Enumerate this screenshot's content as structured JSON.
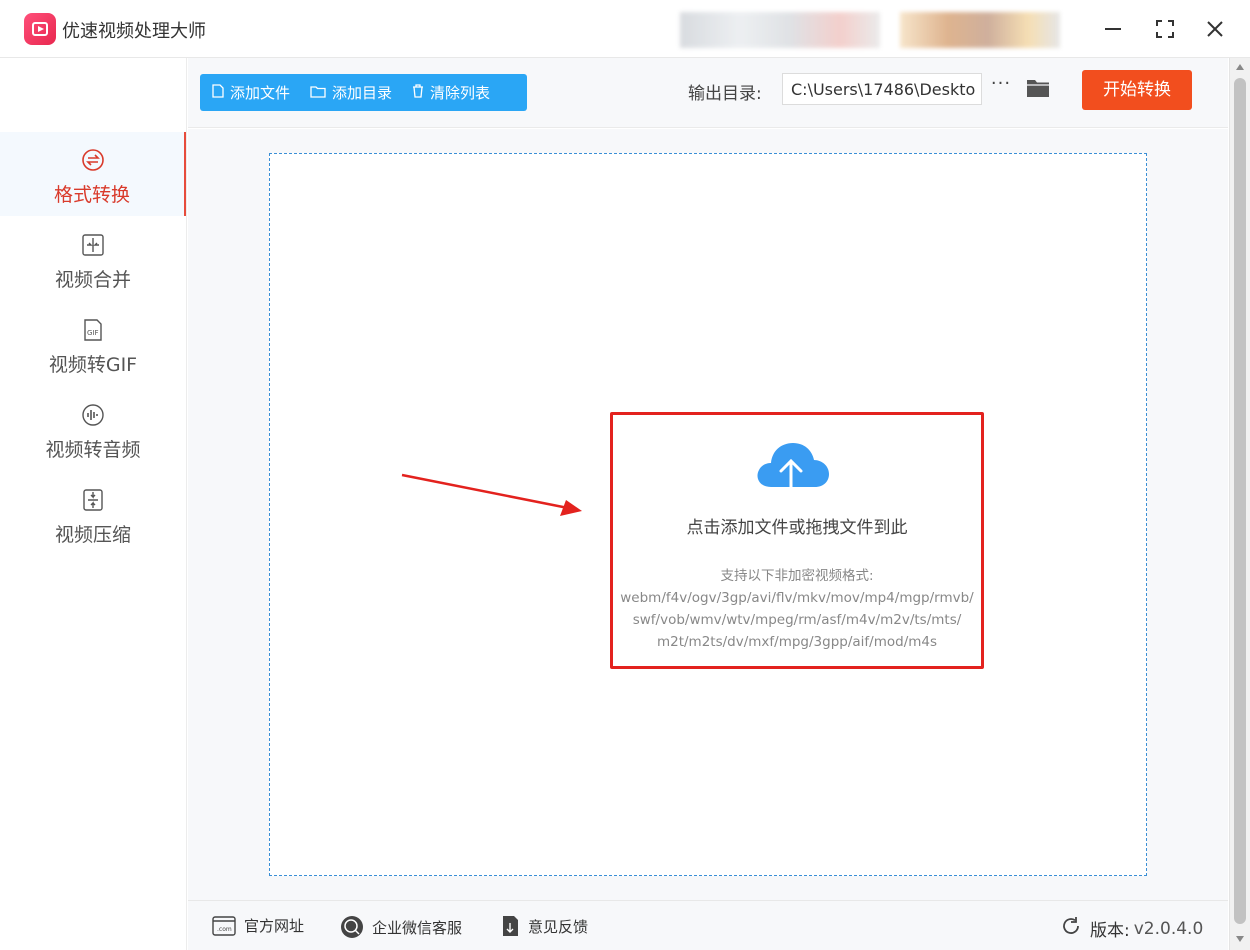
{
  "app": {
    "title": "优速视频处理大师"
  },
  "sidebar": {
    "items": [
      {
        "label": "格式转换",
        "icon": "format-convert-icon",
        "active": true
      },
      {
        "label": "视频合并",
        "icon": "merge-icon",
        "active": false
      },
      {
        "label": "视频转GIF",
        "icon": "gif-icon",
        "active": false
      },
      {
        "label": "视频转音频",
        "icon": "audio-icon",
        "active": false
      },
      {
        "label": "视频压缩",
        "icon": "compress-icon",
        "active": false
      }
    ]
  },
  "toolbar": {
    "add_file": "添加文件",
    "add_dir": "添加目录",
    "clear_list": "清除列表",
    "output_label": "输出目录:",
    "output_path": "C:\\Users\\17486\\Deskto",
    "more": "···",
    "start": "开始转换"
  },
  "dropzone": {
    "title": "点击添加文件或拖拽文件到此",
    "formats_heading": "支持以下非加密视频格式:",
    "formats_lines": [
      "webm/f4v/ogv/3gp/avi/flv/mkv/mov/mp4/mgp/rmvb/",
      "swf/vob/wmv/wtv/mpeg/rm/asf/m4v/m2v/ts/mts/",
      "m2t/m2ts/dv/mxf/mpg/3gpp/aif/mod/m4s"
    ]
  },
  "footer": {
    "website": "官方网址",
    "wechat": "企业微信客服",
    "feedback": "意见反馈",
    "version_label": "版本:",
    "version_num": "v2.0.4.0"
  },
  "colors": {
    "accent_blue": "#2aa6f5",
    "start_red": "#f24e1e",
    "active_red": "#d93a2b",
    "highlight_red": "#e3221e"
  }
}
